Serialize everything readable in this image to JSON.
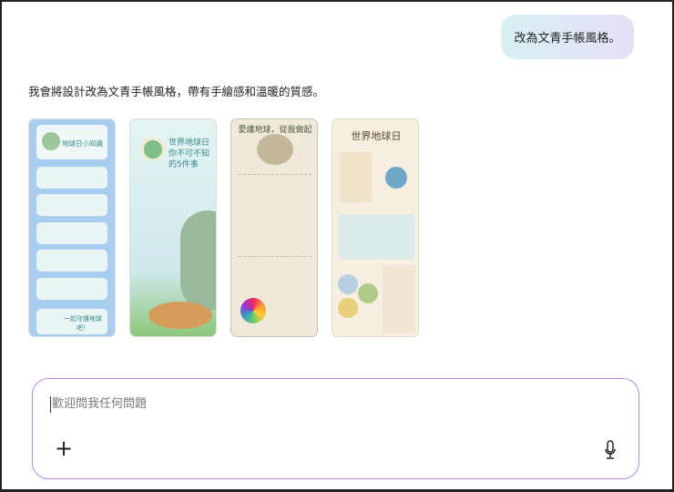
{
  "user_message": "改為文青手帳風格。",
  "assistant_reply": "我會將設計改為文青手帳風格，帶有手繪感和溫暖的質感。",
  "images": [
    {
      "title": "地球日小知識",
      "footer": "一起守護地球吧！"
    },
    {
      "title": "世界地球日 你不可不知的5件事"
    },
    {
      "title": "愛護地球，從我做起"
    },
    {
      "title": "世界地球日"
    }
  ],
  "composer": {
    "placeholder": "歡迎問我任何問題",
    "add_icon": "plus-icon",
    "mic_icon": "microphone-icon"
  }
}
